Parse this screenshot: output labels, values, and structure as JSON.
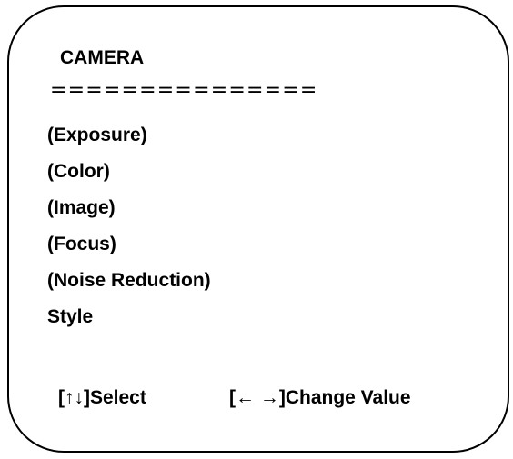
{
  "menu": {
    "title": "CAMERA",
    "separator": "===============",
    "items": [
      {
        "label": "(Exposure)"
      },
      {
        "label": "(Color)"
      },
      {
        "label": "(Image)"
      },
      {
        "label": "(Focus)"
      },
      {
        "label": "(Noise Reduction)"
      },
      {
        "label": "Style"
      }
    ]
  },
  "hints": {
    "select": "[↑↓]Select",
    "change_value": "[← →]Change Value"
  }
}
